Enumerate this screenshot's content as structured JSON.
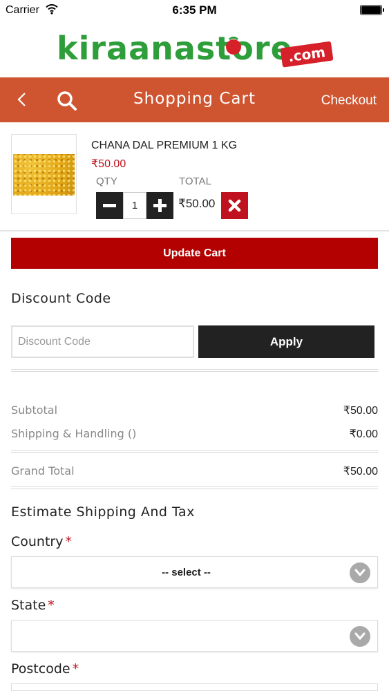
{
  "status_bar": {
    "carrier": "Carrier",
    "time": "6:35 PM"
  },
  "logo": {
    "text": "kiraanastore",
    "suffix": ".com"
  },
  "header": {
    "title": "Shopping Cart",
    "checkout_label": "Checkout"
  },
  "cart": {
    "item": {
      "name": "CHANA DAL PREMIUM 1 KG",
      "price": "₹50.00",
      "qty_label": "QTY",
      "total_label": "TOTAL",
      "qty": "1",
      "line_total": "₹50.00"
    },
    "update_label": "Update Cart"
  },
  "discount": {
    "heading": "Discount Code",
    "placeholder": "Discount Code",
    "apply_label": "Apply"
  },
  "totals": {
    "subtotal_label": "Subtotal",
    "subtotal_value": "₹50.00",
    "shipping_label": "Shipping & Handling ()",
    "shipping_value": "₹0.00",
    "grand_total_label": "Grand Total",
    "grand_total_value": "₹50.00"
  },
  "shipping": {
    "heading": "Estimate Shipping And Tax",
    "country_label": "Country",
    "country_value": "-- select --",
    "state_label": "State",
    "state_value": "",
    "postcode_label": "Postcode",
    "required_mark": "*"
  },
  "colors": {
    "header_bg": "#cf5430",
    "primary_red": "#b30000",
    "price_red": "#c0121e",
    "dark_button": "#222222",
    "logo_green": "#2e9e3a"
  }
}
